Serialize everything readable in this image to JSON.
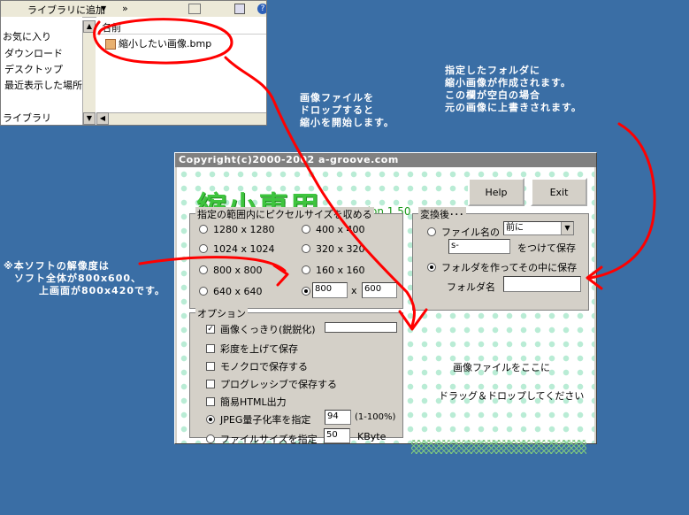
{
  "explorer": {
    "toolbar_library": "ライブラリに追加",
    "toolbar_more": "»",
    "nav_items": [
      "お気に入り",
      "ダウンロード",
      "デスクトップ",
      "最近表示した場所",
      "ライブラリ"
    ],
    "column_name": "名前",
    "file_name": "縮小したい画像.bmp"
  },
  "annotations": {
    "drop_note": [
      "画像ファイルを",
      "ドロップすると",
      "縮小を開始します。"
    ],
    "folder_note": [
      "指定したフォルダに",
      "縮小画像が作成されます。",
      "この欄が空白の場合",
      "元の画像に上書きされます。"
    ],
    "resolution_note": [
      "※本ソフトの解像度は",
      "ソフト全体が800x600、",
      "上画面が800x420です。"
    ]
  },
  "app": {
    "title": "Copyright(c)2000-2002 a-groove.com",
    "logo": "縮小専用",
    "version": "version 1.50",
    "help_label": "Help",
    "exit_label": "Exit",
    "size_group": {
      "title": "指定の範囲内にピクセルサイズを収める",
      "options": [
        "1280 x 1280",
        "1024 x 1024",
        "800 x 800",
        "640 x 640",
        "400 x 400",
        "320 x 320",
        "160 x 160"
      ],
      "custom_width": "800",
      "custom_height": "600",
      "x_label": "x",
      "selected": "custom"
    },
    "convert_group": {
      "title": "変換後･･･",
      "prefix_label": "ファイル名の",
      "prefix_position": "前に",
      "prefix_text": "s-",
      "attach_label": "をつけて保存",
      "folder_option": "フォルダを作ってその中に保存",
      "folder_name_label": "フォルダ名",
      "folder_name_value": "",
      "selected": "folder"
    },
    "options_group": {
      "title": "オプション",
      "sharpen": "画像くっきり(鋭鋭化)",
      "saturation": "彩度を上げて保存",
      "mono": "モノクロで保存する",
      "progressive": "プログレッシブで保存する",
      "html": "簡易HTML出力",
      "jpeg_quality_label": "JPEG量子化率を指定",
      "jpeg_quality_value": "94",
      "jpeg_quality_range": "(1-100%)",
      "filesize_label": "ファイルサイズを指定",
      "filesize_value": "50",
      "filesize_unit": "KByte",
      "checked": [
        "sharpen"
      ],
      "selected": "jpeg_quality"
    },
    "drop_area": {
      "line1": "画像ファイルをここに",
      "line2": "ドラッグ＆ドロップしてください"
    },
    "colors": {
      "logo": "#3ec43e",
      "annotation_arrow": "#ff0000",
      "desktop": "#3a6ea5"
    }
  }
}
